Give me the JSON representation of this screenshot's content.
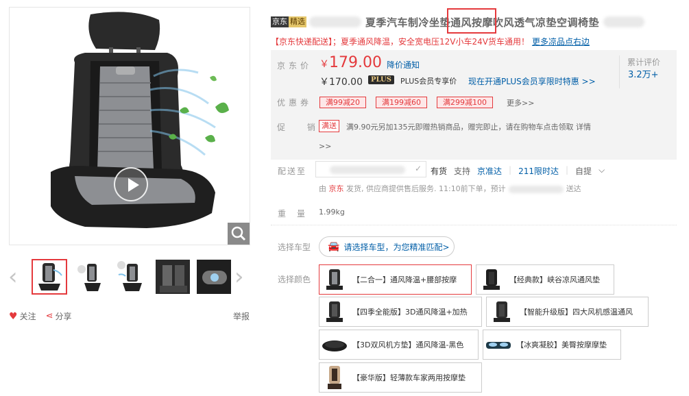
{
  "badge": {
    "part1": "京东",
    "part2": "精选"
  },
  "product_title": "夏季汽车制冷坐垫通风按摩吹风透气凉垫空调椅垫",
  "promo_line": "【京东快递配送】；夏季通风降温，安全宽电压12V小车24V货车通用！",
  "promo_link": "更多凉品点右边",
  "price": {
    "label": "京东价",
    "currency": "￥",
    "value": "179.00",
    "notice": "降价通知",
    "plus_price": "￥170.00",
    "plus_tag": "PLUS",
    "plus_text": "PLUS会员专享价",
    "plus_link": "现在开通PLUS会员享限时特惠 >>"
  },
  "reviews": {
    "label": "累计评价",
    "value": "3.2万+"
  },
  "coupons": {
    "label": "优惠券",
    "items": [
      "满99减20",
      "满199减60",
      "满299减100"
    ],
    "more": "更多>>"
  },
  "promotion": {
    "label": "促  销",
    "tag": "满送",
    "desc": "满9.90元另加135元即赠热销商品，赠完即止，请在购物车点击领取 详情",
    "more": ">>"
  },
  "shipping": {
    "label": "配送至",
    "stock": "有货",
    "support": "支持",
    "service1": "京准达",
    "service2": "211限时达",
    "service3": "自提",
    "sub_prefix": "由",
    "sub_seller": "京东",
    "sub_text": "发货, 供应商提供售后服务. 11:10前下单，预计",
    "sub_suffix": "送达"
  },
  "weight": {
    "label": "重量",
    "value": "1.99kg"
  },
  "car": {
    "label": "选择车型",
    "button": "请选择车型，为您精准匹配>"
  },
  "colors": {
    "label": "选择颜色",
    "options": [
      "【二合一】通风降温+腰部按摩",
      "【经典款】峡谷凉风通风垫",
      "【四季全能版】3D通风降温+加热",
      "【智能升级版】四大风机感温通风",
      "【3D双风机方垫】通风降温-黑色",
      "【冰爽凝胶】美臀按摩摩垫",
      "【豪华版】轻薄款车家两用按摩垫"
    ]
  },
  "actions": {
    "follow": "关注",
    "share": "分享",
    "report": "举报"
  },
  "accent": "#e4393c",
  "link_color": "#005ea7"
}
